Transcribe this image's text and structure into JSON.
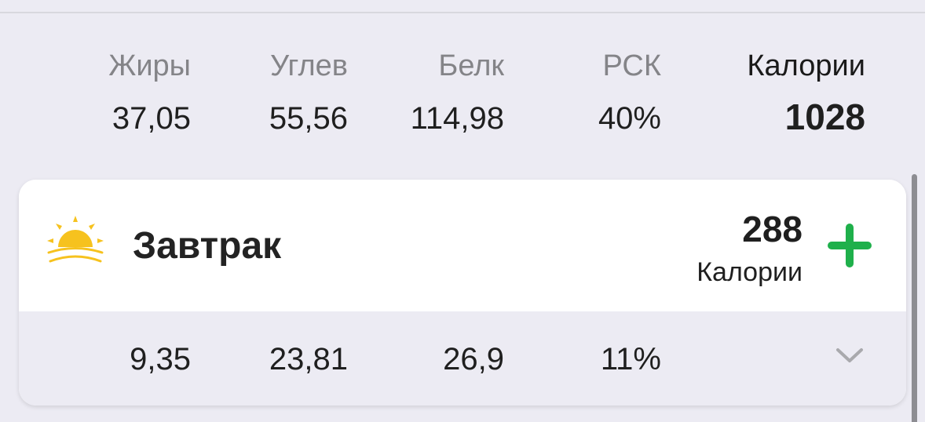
{
  "totals": {
    "labels": [
      "Жиры",
      "Углев",
      "Белк",
      "РСК",
      "Калории"
    ],
    "values": [
      "37,05",
      "55,56",
      "114,98",
      "40%",
      "1028"
    ]
  },
  "meal": {
    "icon": "sunrise-icon",
    "title": "Завтрак",
    "calories": "288",
    "calories_label": "Калории",
    "add_icon": "plus-icon",
    "expand_icon": "chevron-down-icon",
    "values": [
      "9,35",
      "23,81",
      "26,9",
      "11%"
    ]
  },
  "colors": {
    "background": "#ecebf3",
    "card": "#ffffff",
    "accent_green": "#1fb04b",
    "sun_yellow": "#f6c21e",
    "secondary_text": "#848488"
  }
}
